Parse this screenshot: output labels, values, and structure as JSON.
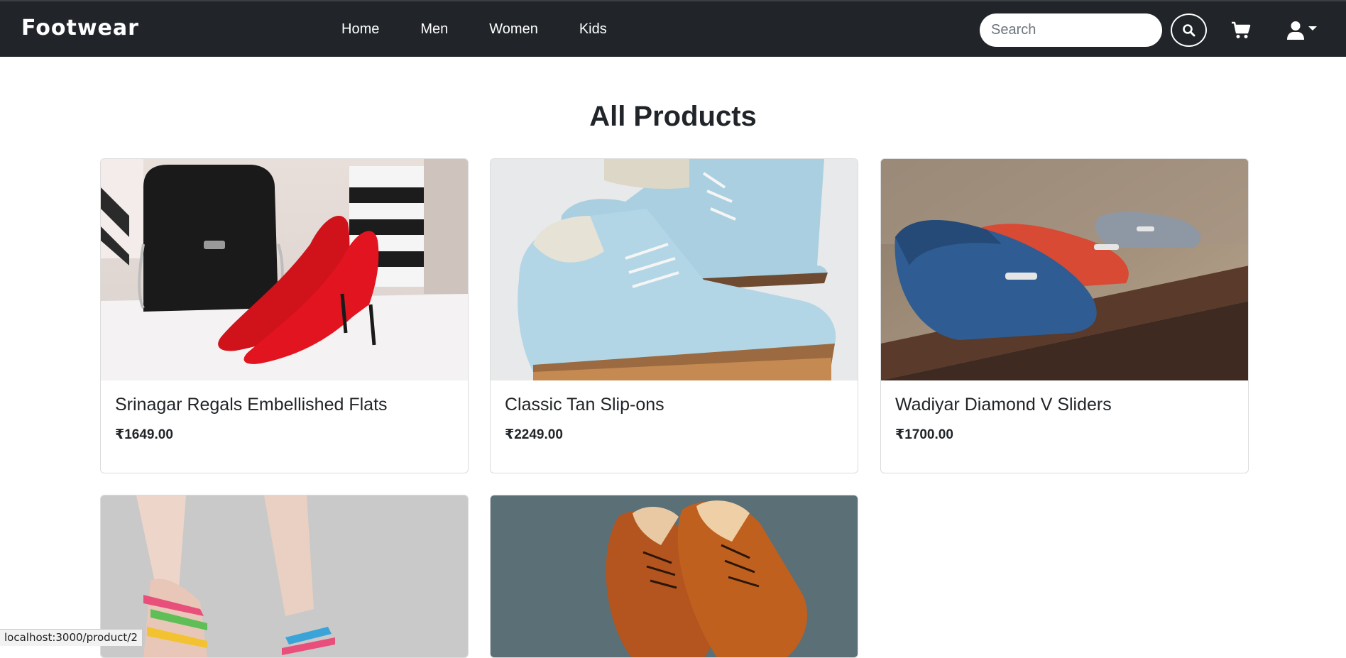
{
  "navbar": {
    "brand": "Footwear",
    "links": [
      "Home",
      "Men",
      "Women",
      "Kids"
    ],
    "search_placeholder": "Search",
    "search_icon": "search-icon",
    "cart_icon": "cart-icon",
    "user_icon": "user-icon"
  },
  "main": {
    "title": "All Products",
    "products": [
      {
        "name": "Srinagar Regals Embellished Flats",
        "price": "₹1649.00",
        "image": "red-stiletto-heels-photo"
      },
      {
        "name": "Classic Tan Slip-ons",
        "price": "₹2249.00",
        "image": "light-blue-boots-photo"
      },
      {
        "name": "Wadiyar Diamond V Sliders",
        "price": "₹1700.00",
        "image": "loafers-on-railing-photo"
      },
      {
        "name": "",
        "price": "",
        "image": "colorful-sandals-photo"
      },
      {
        "name": "",
        "price": "",
        "image": "brown-brogues-photo"
      }
    ]
  },
  "status_bar": {
    "url": "localhost:3000/product/2"
  },
  "colors": {
    "navbar_bg": "#212529",
    "text": "#212529"
  }
}
